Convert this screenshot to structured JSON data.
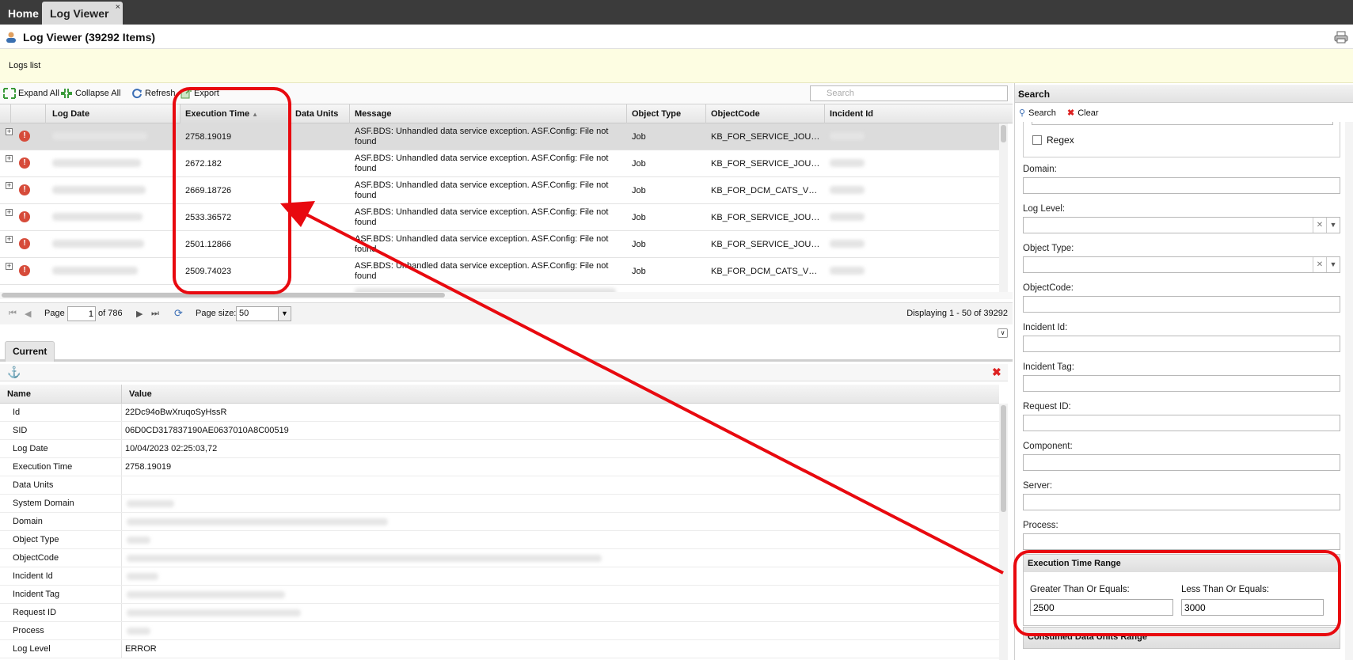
{
  "tabs": [
    {
      "label": "Home"
    },
    {
      "label": "Log Viewer",
      "close": "×"
    }
  ],
  "title": "Log Viewer (39292 Items)",
  "notice": "Logs list",
  "toolbar": {
    "expand_all": "Expand All",
    "collapse_all": "Collapse All",
    "refresh": "Refresh",
    "export": "Export",
    "search_placeholder": "Search"
  },
  "grid": {
    "columns": [
      "Log Date",
      "Execution Time",
      "Data Units",
      "Message",
      "Object Type",
      "ObjectCode",
      "Incident Id"
    ],
    "sort_indicator": "▲",
    "rows": [
      {
        "exec": "2758.19019",
        "message": "ASF.BDS: Unhandled data service exception. ASF.Config: File not found",
        "type": "Job",
        "code": "KB_FOR_SERVICE_JOU…"
      },
      {
        "exec": "2672.182",
        "message": "ASF.BDS: Unhandled data service exception. ASF.Config: File not found",
        "type": "Job",
        "code": "KB_FOR_SERVICE_JOU…"
      },
      {
        "exec": "2669.18726",
        "message": "ASF.BDS: Unhandled data service exception. ASF.Config: File not found",
        "type": "Job",
        "code": "KB_FOR_DCM_CATS_V…"
      },
      {
        "exec": "2533.36572",
        "message": "ASF.BDS: Unhandled data service exception. ASF.Config: File not found",
        "type": "Job",
        "code": "KB_FOR_SERVICE_JOU…"
      },
      {
        "exec": "2501.12866",
        "message": "ASF.BDS: Unhandled data service exception. ASF.Config: File not found",
        "type": "Job",
        "code": "KB_FOR_SERVICE_JOU…"
      },
      {
        "exec": "2509.74023",
        "message": "ASF.BDS: Unhandled data service exception. ASF.Config: File not found",
        "type": "Job",
        "code": "KB_FOR_DCM_CATS_V…"
      }
    ]
  },
  "paging": {
    "page_label": "Page",
    "page_value": "1",
    "of_label": "of 786",
    "page_size_label": "Page size:",
    "page_size": "50",
    "displaying": "Displaying 1 - 50 of 39292"
  },
  "detail": {
    "tab": "Current",
    "col_name": "Name",
    "col_value": "Value",
    "rows": [
      {
        "name": "Id",
        "value": "22Dc94oBwXruqoSyHssR"
      },
      {
        "name": "SID",
        "value": "06D0CD317837190AE0637010A8C00519"
      },
      {
        "name": "Log Date",
        "value": "10/04/2023 02:25:03,72"
      },
      {
        "name": "Execution Time",
        "value": "2758.19019"
      },
      {
        "name": "Data Units",
        "value": ""
      },
      {
        "name": "System Domain",
        "value": ""
      },
      {
        "name": "Domain",
        "value": ""
      },
      {
        "name": "Object Type",
        "value": ""
      },
      {
        "name": "ObjectCode",
        "value": ""
      },
      {
        "name": "Incident Id",
        "value": ""
      },
      {
        "name": "Incident Tag",
        "value": ""
      },
      {
        "name": "Request ID",
        "value": ""
      },
      {
        "name": "Process",
        "value": ""
      },
      {
        "name": "Log Level",
        "value": "ERROR"
      }
    ]
  },
  "search_panel": {
    "title": "Search",
    "search_btn": "Search",
    "clear_btn": "Clear",
    "regex_label": "Regex",
    "fields": [
      "Domain:",
      "Log Level:",
      "Object Type:",
      "ObjectCode:",
      "Incident Id:",
      "Incident Tag:",
      "Request ID:",
      "Component:",
      "Server:",
      "Process:"
    ],
    "exec_range": {
      "title": "Execution Time Range",
      "gte_label": "Greater Than Or Equals:",
      "gte_value": "2500",
      "lte_label": "Less Than Or Equals:",
      "lte_value": "3000"
    },
    "data_units_range_title": "Consumed Data Units Range"
  },
  "colors": {
    "annotation": "#e8090f",
    "error_icon": "#d64b3a",
    "tabbar": "#3b3b3b",
    "notice_bg": "#fdfde2"
  },
  "icons": [
    "user-icon",
    "print-icon",
    "expand-all-icon",
    "collapse-all-icon",
    "refresh-icon",
    "export-icon",
    "search-icon",
    "error-icon",
    "anchor-icon",
    "close-icon",
    "clear-icon"
  ]
}
